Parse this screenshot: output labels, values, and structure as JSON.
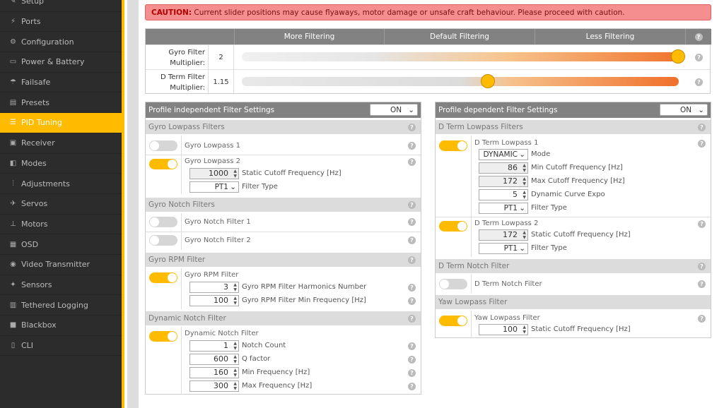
{
  "sidebar": {
    "items": [
      {
        "label": "Setup",
        "icon": "wrench-icon"
      },
      {
        "label": "Ports",
        "icon": "plug-icon"
      },
      {
        "label": "Configuration",
        "icon": "gear-icon"
      },
      {
        "label": "Power & Battery",
        "icon": "battery-icon"
      },
      {
        "label": "Failsafe",
        "icon": "parachute-icon"
      },
      {
        "label": "Presets",
        "icon": "folder-icon"
      },
      {
        "label": "PID Tuning",
        "icon": "sliders-icon"
      },
      {
        "label": "Receiver",
        "icon": "receiver-icon"
      },
      {
        "label": "Modes",
        "icon": "toggle-icon"
      },
      {
        "label": "Adjustments",
        "icon": "adjustments-icon"
      },
      {
        "label": "Servos",
        "icon": "servo-icon"
      },
      {
        "label": "Motors",
        "icon": "motor-icon"
      },
      {
        "label": "OSD",
        "icon": "osd-icon"
      },
      {
        "label": "Video Transmitter",
        "icon": "antenna-icon"
      },
      {
        "label": "Sensors",
        "icon": "sensor-icon"
      },
      {
        "label": "Tethered Logging",
        "icon": "log-icon"
      },
      {
        "label": "Blackbox",
        "icon": "blackbox-icon"
      },
      {
        "label": "CLI",
        "icon": "terminal-icon"
      }
    ],
    "active": "PID Tuning"
  },
  "caution": {
    "strong": "CAUTION:",
    "text": " Current slider positions may cause flyaways, motor damage or unsafe craft behaviour. Please proceed with caution."
  },
  "sliders": {
    "header": [
      "More Filtering",
      "Default Filtering",
      "Less Filtering"
    ],
    "rows": [
      {
        "label1": "Gyro Filter",
        "label2": "Multiplier:",
        "value": "2",
        "position": 1.0
      },
      {
        "label1": "D Term Filter",
        "label2": "Multiplier:",
        "value": "1.15",
        "position": 0.55
      }
    ]
  },
  "help_glyph": "?",
  "left": {
    "title": "Profile independent Filter Settings",
    "toggle": "ON",
    "gyro_lowpass": {
      "title": "Gyro Lowpass Filters",
      "lp1": "Gyro Lowpass 1",
      "lp2": "Gyro Lowpass 2",
      "lp2_freq": "1000",
      "lp2_freq_label": "Static Cutoff Frequency [Hz]",
      "lp2_type": "PT1",
      "type_label": "Filter Type"
    },
    "gyro_notch": {
      "title": "Gyro Notch Filters",
      "n1": "Gyro Notch Filter 1",
      "n2": "Gyro Notch Filter 2"
    },
    "gyro_rpm": {
      "title": "Gyro RPM Filter",
      "label": "Gyro RPM Filter",
      "harmonics": "3",
      "harmonics_label": "Gyro RPM Filter Harmonics Number",
      "minfreq": "100",
      "minfreq_label": "Gyro RPM Filter Min Frequency [Hz]"
    },
    "dyn_notch": {
      "title": "Dynamic Notch Filter",
      "label": "Dynamic Notch Filter",
      "count": "1",
      "count_label": "Notch Count",
      "q": "600",
      "q_label": "Q factor",
      "min": "160",
      "min_label": "Min Frequency [Hz]",
      "max": "300",
      "max_label": "Max Frequency [Hz]"
    }
  },
  "right": {
    "title": "Profile dependent Filter Settings",
    "toggle": "ON",
    "dterm_lowpass": {
      "title": "D Term Lowpass Filters",
      "lp1": "D Term Lowpass 1",
      "mode": "DYNAMIC",
      "mode_label": "Mode",
      "minc": "86",
      "minc_label": "Min Cutoff Frequency [Hz]",
      "maxc": "172",
      "maxc_label": "Max Cutoff Frequency [Hz]",
      "expo": "5",
      "expo_label": "Dynamic Curve Expo",
      "type1": "PT1",
      "type_label": "Filter Type",
      "lp2": "D Term Lowpass 2",
      "lp2_freq": "172",
      "lp2_freq_label": "Static Cutoff Frequency [Hz]",
      "type2": "PT1"
    },
    "dterm_notch": {
      "title": "D Term Notch Filter",
      "label": "D Term Notch Filter"
    },
    "yaw": {
      "title": "Yaw Lowpass Filter",
      "label": "Yaw Lowpass Filter",
      "freq": "100",
      "freq_label": "Static Cutoff Frequency [Hz]"
    }
  },
  "colors": {
    "accent": "#ffbb00",
    "caution_bg": "#f58e8e",
    "header_bg": "#828282"
  }
}
